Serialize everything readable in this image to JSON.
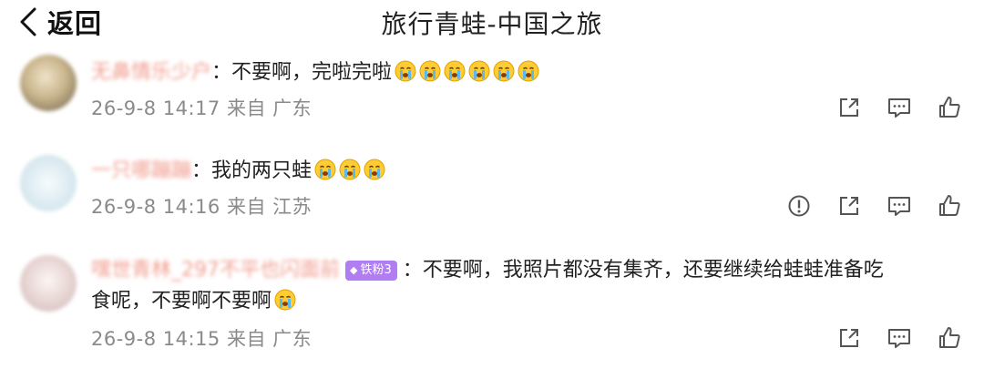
{
  "header": {
    "back_label": "返回",
    "title": "旅行青蛙-中国之旅"
  },
  "comments": [
    {
      "username": "无鼻情乐少户",
      "text": "：不要啊，完啦完啦",
      "emojis": [
        "crying-emoji",
        "crying-emoji",
        "crying-emoji",
        "crying-emoji",
        "crying-emoji",
        "crying-emoji"
      ],
      "meta": "26-9-8 14:17 来自 广东",
      "actions": [
        "share-icon",
        "comment-icon",
        "like-icon"
      ]
    },
    {
      "username": "一只哪蹦蹦",
      "text": "：我的两只蛙",
      "emojis": [
        "crying-emoji",
        "crying-emoji",
        "crying-emoji"
      ],
      "meta": "26-9-8 14:16 来自 江苏",
      "actions": [
        "report-icon",
        "share-icon",
        "comment-icon",
        "like-icon"
      ]
    },
    {
      "username": "嘿世青林_297不平也闪面前",
      "badge": "铁粉3",
      "text": "：不要啊，我照片都没有集齐，还要继续给蛙蛙准备吃",
      "text_cont": "食呢，不要啊不要啊",
      "emojis": [
        "crying-emoji"
      ],
      "meta": "26-9-8 14:15 来自 广东",
      "actions": [
        "share-icon",
        "comment-icon",
        "like-icon"
      ]
    }
  ]
}
